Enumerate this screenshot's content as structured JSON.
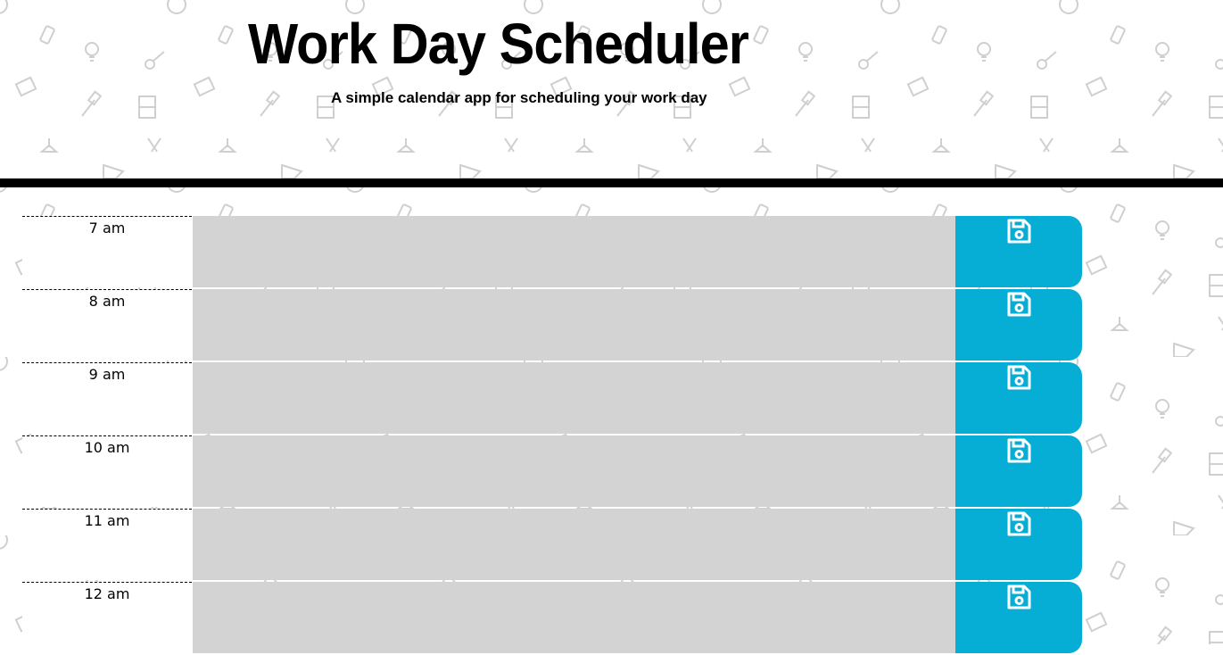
{
  "header": {
    "title": "Work Day Scheduler",
    "subtitle": "A simple calendar app for scheduling your work day"
  },
  "time_blocks": [
    {
      "hour": "7 am",
      "description": ""
    },
    {
      "hour": "8 am",
      "description": ""
    },
    {
      "hour": "9 am",
      "description": ""
    },
    {
      "hour": "10 am",
      "description": ""
    },
    {
      "hour": "11 am",
      "description": ""
    },
    {
      "hour": "12 am",
      "description": ""
    }
  ],
  "icons": {
    "save": "save-icon"
  },
  "colors": {
    "past_block": "#d3d3d3",
    "save_button": "#06aed5",
    "divider": "#000000",
    "pattern_icon": "#d0d0d0"
  }
}
